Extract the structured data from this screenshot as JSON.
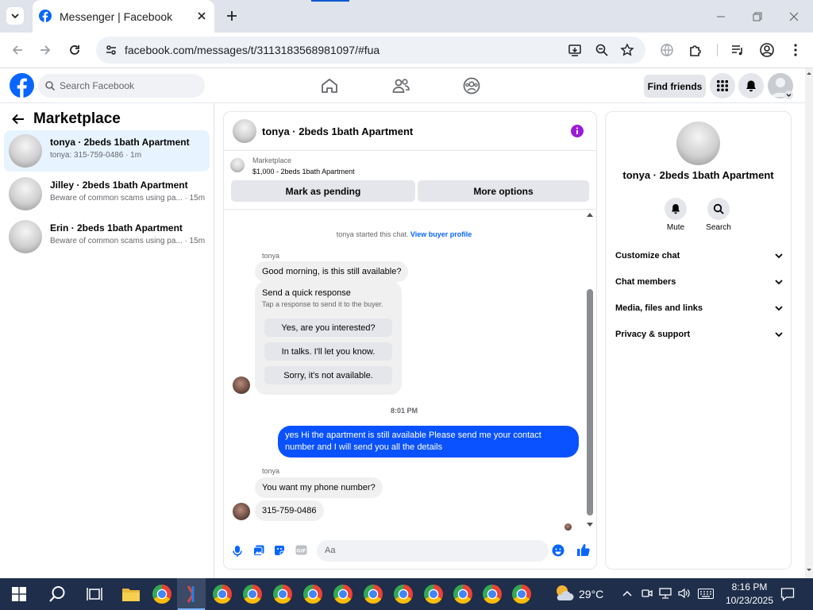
{
  "browser": {
    "tab_title": "Messenger | Facebook",
    "url": "facebook.com/messages/t/3113183568981097/#fua"
  },
  "fb_header": {
    "search_placeholder": "Search Facebook",
    "find_friends": "Find friends"
  },
  "left": {
    "title": "Marketplace",
    "conversations": [
      {
        "name": "tonya · 2beds 1bath Apartment",
        "sub": "tonya: 315-759-0486 · 1m"
      },
      {
        "name": "Jilley · 2beds 1bath Apartment",
        "sub": "Beware of common scams using pa... · 15m"
      },
      {
        "name": "Erin · 2beds 1bath Apartment",
        "sub": "Beware of common scams using pa... · 15m"
      }
    ]
  },
  "chat": {
    "title": "tonya · 2beds 1bath Apartment",
    "listing_source": "Marketplace",
    "listing_price": "$1,000 - 2beds 1bath Apartment",
    "mark_pending": "Mark as pending",
    "more_options": "More options",
    "started_text": "tonya started this chat.",
    "view_profile": "View buyer profile",
    "sender1": "tonya",
    "msg1": "Good morning, is this still available?",
    "quick_title": "Send a quick response",
    "quick_sub": "Tap a response to send it to the buyer.",
    "quick_options": [
      "Yes, are you interested?",
      "In talks. I'll let you know.",
      "Sorry, it's not available."
    ],
    "time": "8:01 PM",
    "my_msg": "yes Hi the apartment is still available Please send me your contact number and I will send you all the details",
    "sender2": "tonya",
    "msg2": "You want my phone number?",
    "msg3": "315-759-0486",
    "composer_placeholder": "Aa"
  },
  "right": {
    "name": "tonya · 2beds 1bath Apartment",
    "mute": "Mute",
    "search": "Search",
    "rows": [
      "Customize chat",
      "Chat members",
      "Media, files and links",
      "Privacy & support"
    ]
  },
  "taskbar": {
    "weather": "29°C",
    "time": "8:16 PM",
    "date": "10/23/2025"
  },
  "colors": {
    "fb_blue": "#0866ff",
    "messenger_blue": "#0a52ff",
    "taskbar": "#1f2e4a"
  }
}
